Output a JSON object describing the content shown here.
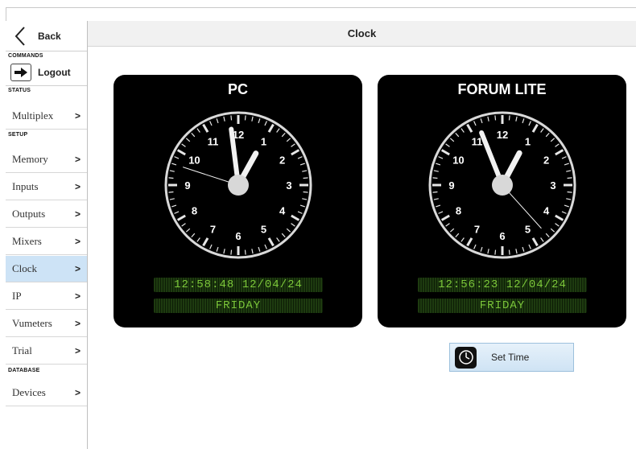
{
  "header": {
    "title": "Clock"
  },
  "sidebar": {
    "back_label": "Back",
    "sections": {
      "commands": "COMMANDS",
      "status": "STATUS",
      "setup": "SETUP",
      "database": "DATABASE"
    },
    "logout_label": "Logout",
    "items": [
      {
        "label": "Multiplex",
        "chevron": ">"
      },
      {
        "label": "Memory",
        "chevron": ">"
      },
      {
        "label": "Inputs",
        "chevron": ">"
      },
      {
        "label": "Outputs",
        "chevron": ">"
      },
      {
        "label": "Mixers",
        "chevron": ">"
      },
      {
        "label": "Clock",
        "chevron": ">",
        "active": true
      },
      {
        "label": "IP",
        "chevron": ">"
      },
      {
        "label": "Vumeters",
        "chevron": ">"
      },
      {
        "label": "Trial",
        "chevron": ">"
      },
      {
        "label": "Devices",
        "chevron": ">"
      }
    ]
  },
  "clocks": [
    {
      "title": "PC",
      "datetime": "12:58:48 12/04/24",
      "day": "FRIDAY",
      "hour": 12,
      "minute": 58,
      "second": 48
    },
    {
      "title": "FORUM LITE",
      "datetime": "12:56:23 12/04/24",
      "day": "FRIDAY",
      "hour": 12,
      "minute": 56,
      "second": 23
    }
  ],
  "dial_numbers": [
    "12",
    "1",
    "2",
    "3",
    "4",
    "5",
    "6",
    "7",
    "8",
    "9",
    "10",
    "11"
  ],
  "set_time_label": "Set Time",
  "colors": {
    "active_item": "#cde3f6",
    "lcd_text": "#7cc73a",
    "panel": "#000000"
  }
}
